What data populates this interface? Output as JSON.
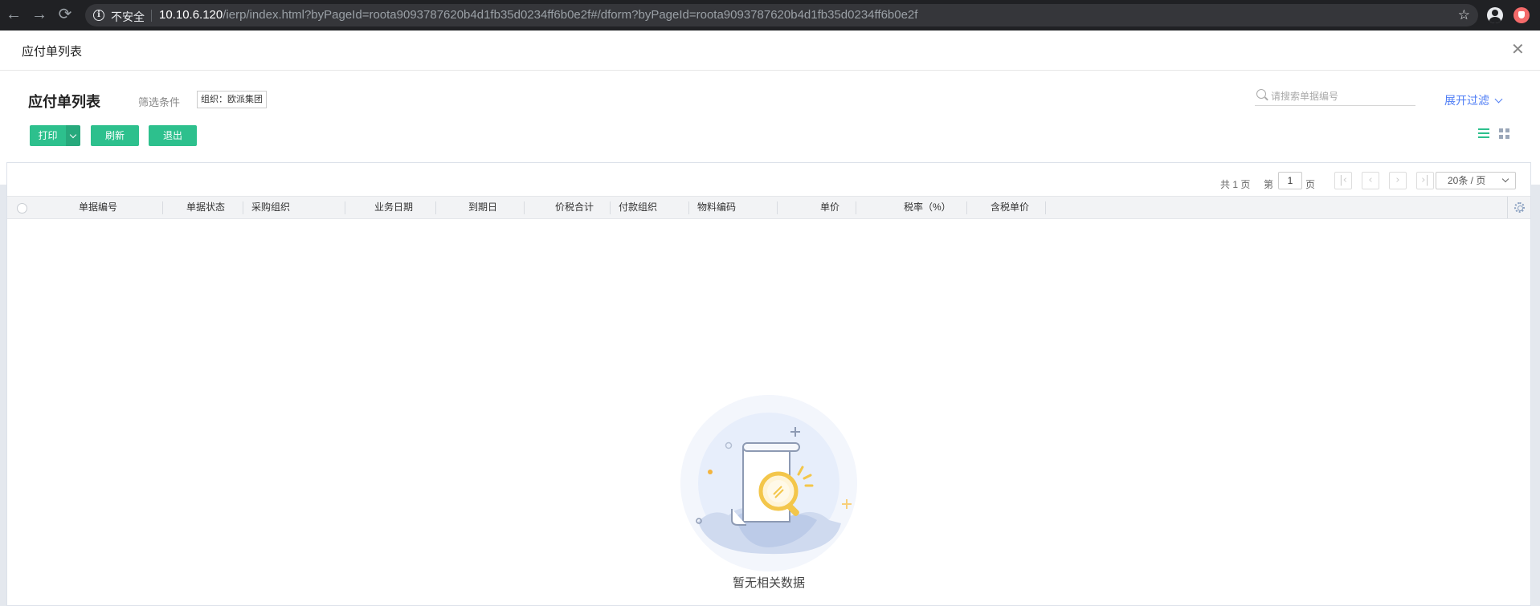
{
  "browser": {
    "security_label": "不安全",
    "url_host": "10.10.6.120",
    "url_path": "/ierp/index.html?byPageId=roota9093787620b4d1fb35d0234ff6b0e2f#/dform?byPageId=roota9093787620b4d1fb35d0234ff6b0e2f"
  },
  "window": {
    "tab_title": "应付单列表"
  },
  "header": {
    "title": "应付单列表",
    "filter_label": "筛选条件",
    "filter_tag": "组织：欧派集团",
    "search_placeholder": "请搜索单据编号",
    "expand_filter": "展开过滤"
  },
  "toolbar": {
    "print_label": "打印",
    "refresh_label": "刷新",
    "exit_label": "退出"
  },
  "pager": {
    "total_text": "共 1 页",
    "page_prefix": "第",
    "current_page": "1",
    "page_suffix": "页",
    "page_size": "20条 / 页"
  },
  "table": {
    "columns": [
      "单据编号",
      "单据状态",
      "采购组织",
      "业务日期",
      "到期日",
      "价税合计",
      "付款组织",
      "物料编码",
      "单价",
      "税率（%）",
      "含税单价"
    ]
  },
  "empty_state": {
    "message": "暂无相关数据"
  },
  "colors": {
    "primary_button": "#2dc08d",
    "link": "#4d7cf5"
  }
}
